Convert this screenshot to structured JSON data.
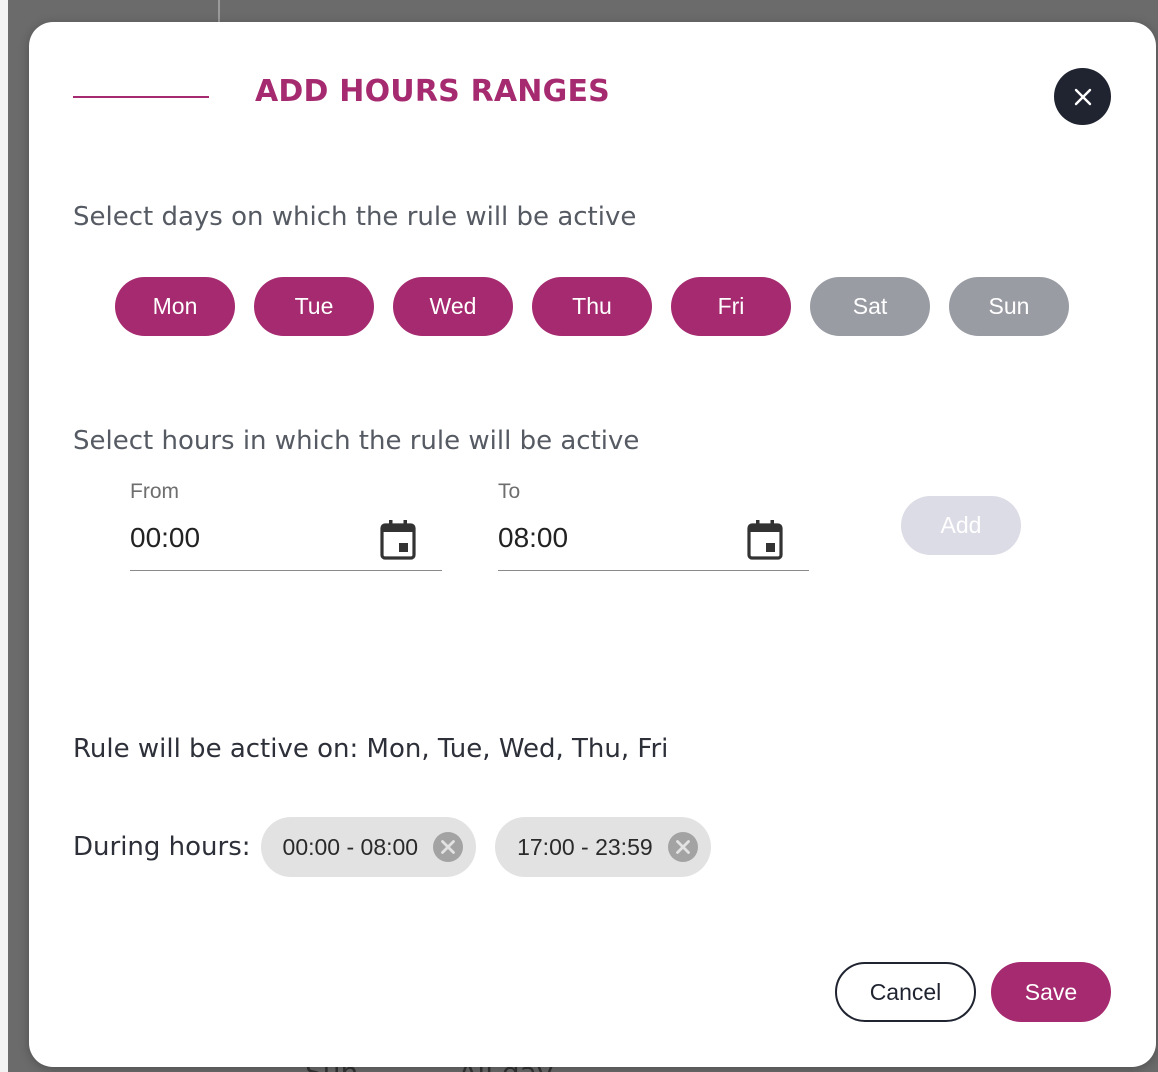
{
  "modal": {
    "title": "ADD HOURS RANGES",
    "close_icon": "close-icon",
    "accent_color": "#a52a6f",
    "inactive_color": "#9a9ca4"
  },
  "background": {
    "bottom_text_left": "Sun",
    "bottom_text_right": "All day"
  },
  "days_section": {
    "label": "Select days on which the rule will be active",
    "days": [
      {
        "label": "Mon",
        "selected": true
      },
      {
        "label": "Tue",
        "selected": true
      },
      {
        "label": "Wed",
        "selected": true
      },
      {
        "label": "Thu",
        "selected": true
      },
      {
        "label": "Fri",
        "selected": true
      },
      {
        "label": "Sat",
        "selected": false
      },
      {
        "label": "Sun",
        "selected": false
      }
    ]
  },
  "hours_section": {
    "label": "Select hours in which the rule will be active",
    "from": {
      "label": "From",
      "value": "00:00",
      "icon": "calendar-icon"
    },
    "to": {
      "label": "To",
      "value": "08:00",
      "icon": "calendar-icon"
    },
    "add_label": "Add"
  },
  "summary": {
    "active_on_text": "Rule will be active on: Mon, Tue, Wed, Thu, Fri",
    "during_label": "During hours:",
    "ranges": [
      {
        "label": "00:00 - 08:00",
        "icon": "remove-circle-icon"
      },
      {
        "label": "17:00 - 23:59",
        "icon": "remove-circle-icon"
      }
    ]
  },
  "footer": {
    "cancel_label": "Cancel",
    "save_label": "Save"
  }
}
